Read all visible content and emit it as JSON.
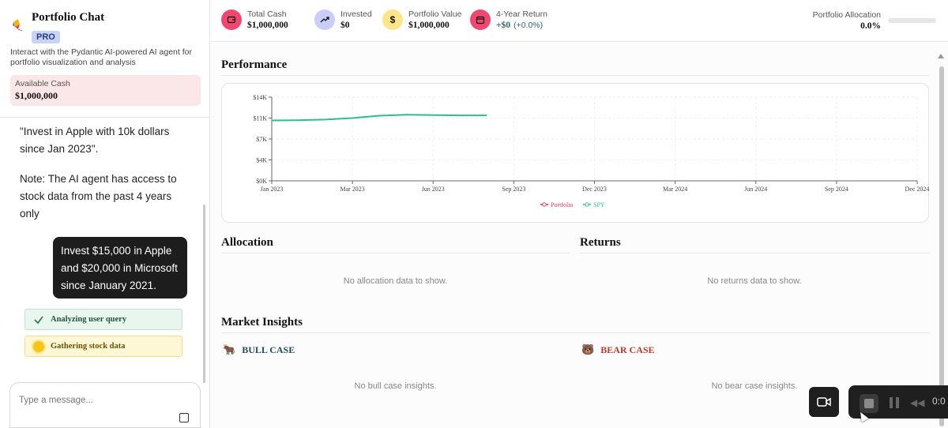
{
  "app": {
    "title": "Portfolio Chat",
    "badge": "PRO",
    "description": "Interact with the Pydantic AI-powered AI agent for portfolio visualization and analysis",
    "available_cash_label": "Available Cash",
    "available_cash_value": "$1,000,000"
  },
  "chat": {
    "assistant_lines": [
      "\"Invest in Apple with 10k dollars since Jan 2023\".",
      "Note: The AI agent has access to stock data from the past 4 years only"
    ],
    "user_message": "Invest $15,000 in Apple and $20,000 in Microsoft since January 2021.",
    "status_items": [
      {
        "label": "Analyzing user query",
        "icon": "check-icon"
      },
      {
        "label": "Gathering stock data",
        "icon": "sun-icon"
      }
    ],
    "input_placeholder": "Type a message..."
  },
  "stats": [
    {
      "label": "Total Cash",
      "value": "$1,000,000",
      "icon": "wallet-icon",
      "color": "#ef476f"
    },
    {
      "label": "Invested",
      "value": "$0",
      "icon": "trending-up-icon",
      "color": "#c9cdfa"
    },
    {
      "label": "Portfolio Value",
      "value": "$1,000,000",
      "icon": "dollar-icon",
      "color": "#fde68a"
    },
    {
      "label": "4-Year Return",
      "value": "+$0",
      "pct": "(+0.0%)",
      "icon": "calendar-icon",
      "color": "#ef476f"
    }
  ],
  "allocation_summary": {
    "label": "Portfolio Allocation",
    "value": "0.0%"
  },
  "sections": {
    "performance": "Performance",
    "allocation": "Allocation",
    "returns": "Returns",
    "market_insights": "Market Insights",
    "allocation_empty": "No allocation data to show.",
    "returns_empty": "No returns data to show.",
    "bull_title": "BULL CASE",
    "bear_title": "BEAR CASE",
    "bull_empty": "No bull case insights.",
    "bear_empty": "No bear case insights."
  },
  "recorder": {
    "time": "0:0"
  },
  "chart_data": {
    "type": "line",
    "x_ticks": [
      "Jan 2023",
      "Mar 2023",
      "Jun 2023",
      "Sep 2023",
      "Dec 2023",
      "Mar 2024",
      "Jun 2024",
      "Sep 2024",
      "Dec 2024"
    ],
    "y_ticks": [
      "$0K",
      "$4K",
      "$7K",
      "$11K",
      "$14K"
    ],
    "ylim": [
      0,
      14000
    ],
    "x_range": [
      "2023-01",
      "2024-12"
    ],
    "series": [
      {
        "name": "Portfolio",
        "color": "#e23b5a",
        "points": []
      },
      {
        "name": "SPY",
        "color": "#2bbf8e",
        "points": [
          [
            "2023-01",
            10100
          ],
          [
            "2023-02",
            10150
          ],
          [
            "2023-03",
            10250
          ],
          [
            "2023-04",
            10500
          ],
          [
            "2023-05",
            10900
          ],
          [
            "2023-06",
            11050
          ],
          [
            "2023-07",
            11000
          ],
          [
            "2023-08",
            10950
          ],
          [
            "2023-09",
            10950
          ]
        ]
      }
    ],
    "grid": true,
    "legend": "bottom-center"
  }
}
